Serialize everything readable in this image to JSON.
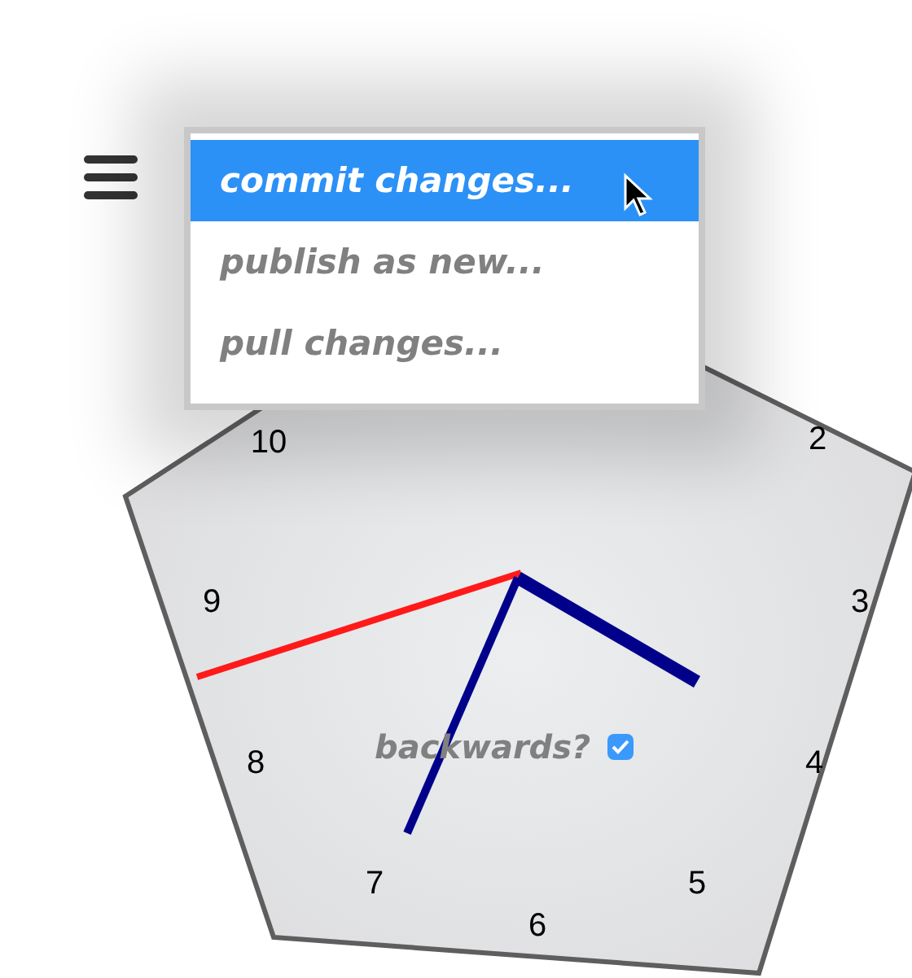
{
  "menu": {
    "items": [
      {
        "label": "commit changes...",
        "selected": true
      },
      {
        "label": "publish as new...",
        "selected": false
      },
      {
        "label": "pull changes...",
        "selected": false
      }
    ]
  },
  "clock": {
    "numerals": [
      "10",
      "2",
      "9",
      "3",
      "8",
      "4",
      "7",
      "5",
      "6"
    ]
  },
  "backwards": {
    "label": "backwards?",
    "checked": true
  }
}
